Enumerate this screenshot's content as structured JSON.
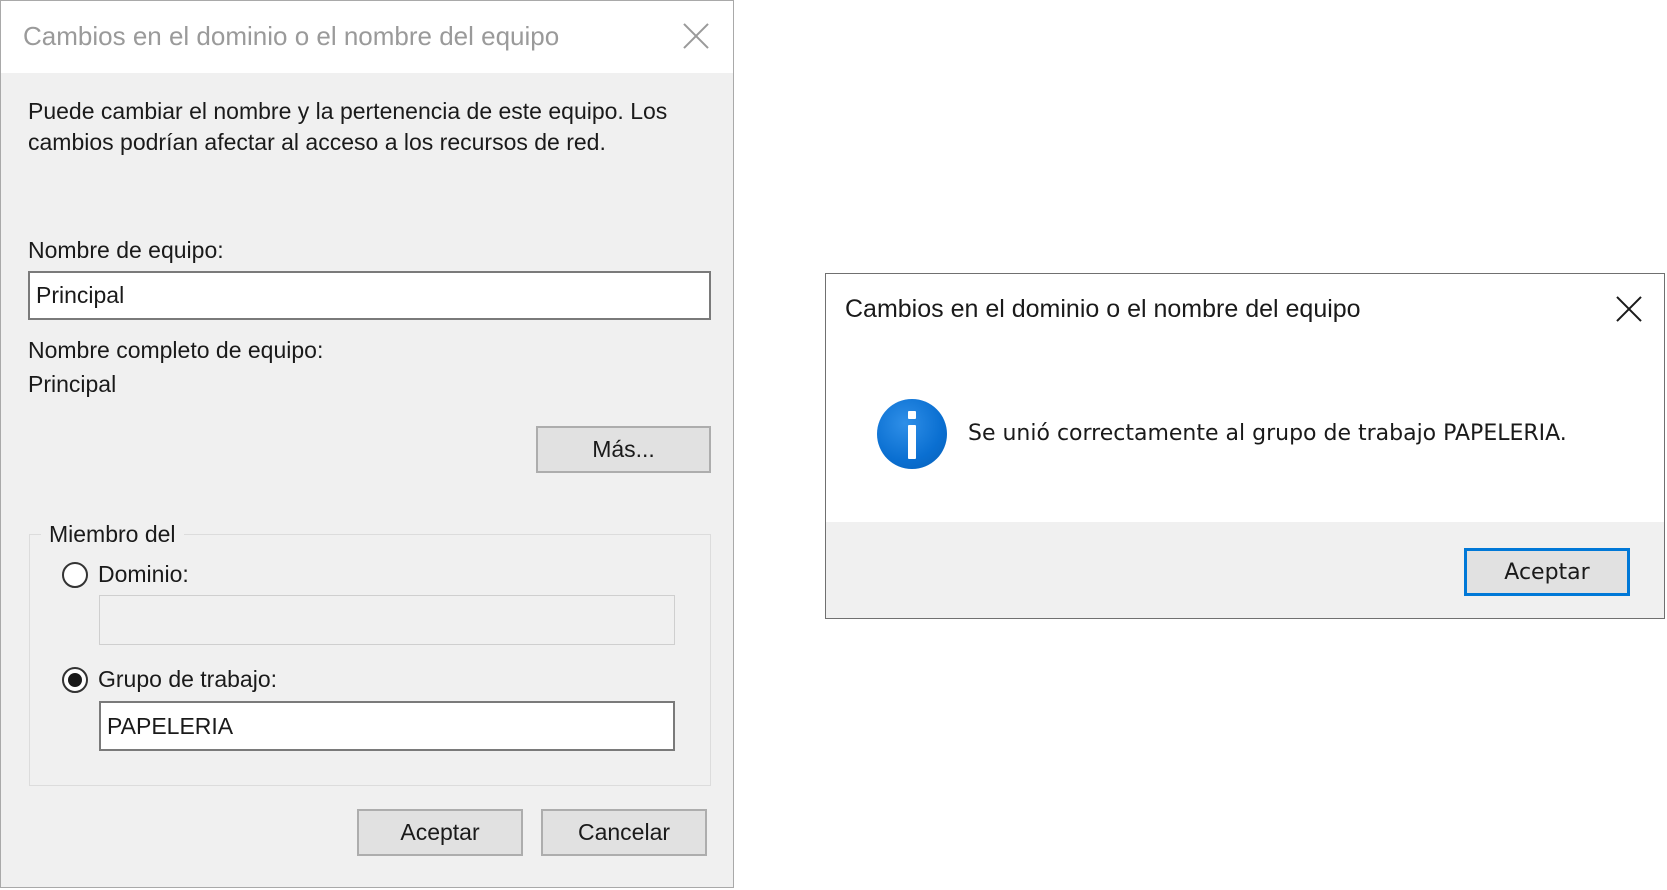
{
  "left_dialog": {
    "title": "Cambios en el dominio o el nombre del equipo",
    "intro_line1": "Puede cambiar el nombre y la pertenencia de este equipo. Los",
    "intro_line2": "cambios podrían afectar al acceso a los recursos de red.",
    "computer_name_label": "Nombre de equipo:",
    "computer_name_value": "Principal",
    "full_name_label": "Nombre completo de equipo:",
    "full_name_value": "Principal",
    "more_button": "Más...",
    "member_of_label": "Miembro del",
    "domain_label": "Dominio:",
    "domain_value": "",
    "domain_selected": false,
    "workgroup_label": "Grupo de trabajo:",
    "workgroup_value": "PAPELERIA",
    "workgroup_selected": true,
    "ok_button": "Aceptar",
    "cancel_button": "Cancelar"
  },
  "right_dialog": {
    "title": "Cambios en el dominio o el nombre del equipo",
    "icon": "info-icon",
    "message": "Se unió correctamente al grupo de trabajo PAPELERIA.",
    "ok_button": "Aceptar"
  },
  "colors": {
    "accent": "#0078d7",
    "info_icon": "#0a6fd1",
    "dialog_bg": "#f0f0f0",
    "inactive_title": "#9a9a9a"
  }
}
